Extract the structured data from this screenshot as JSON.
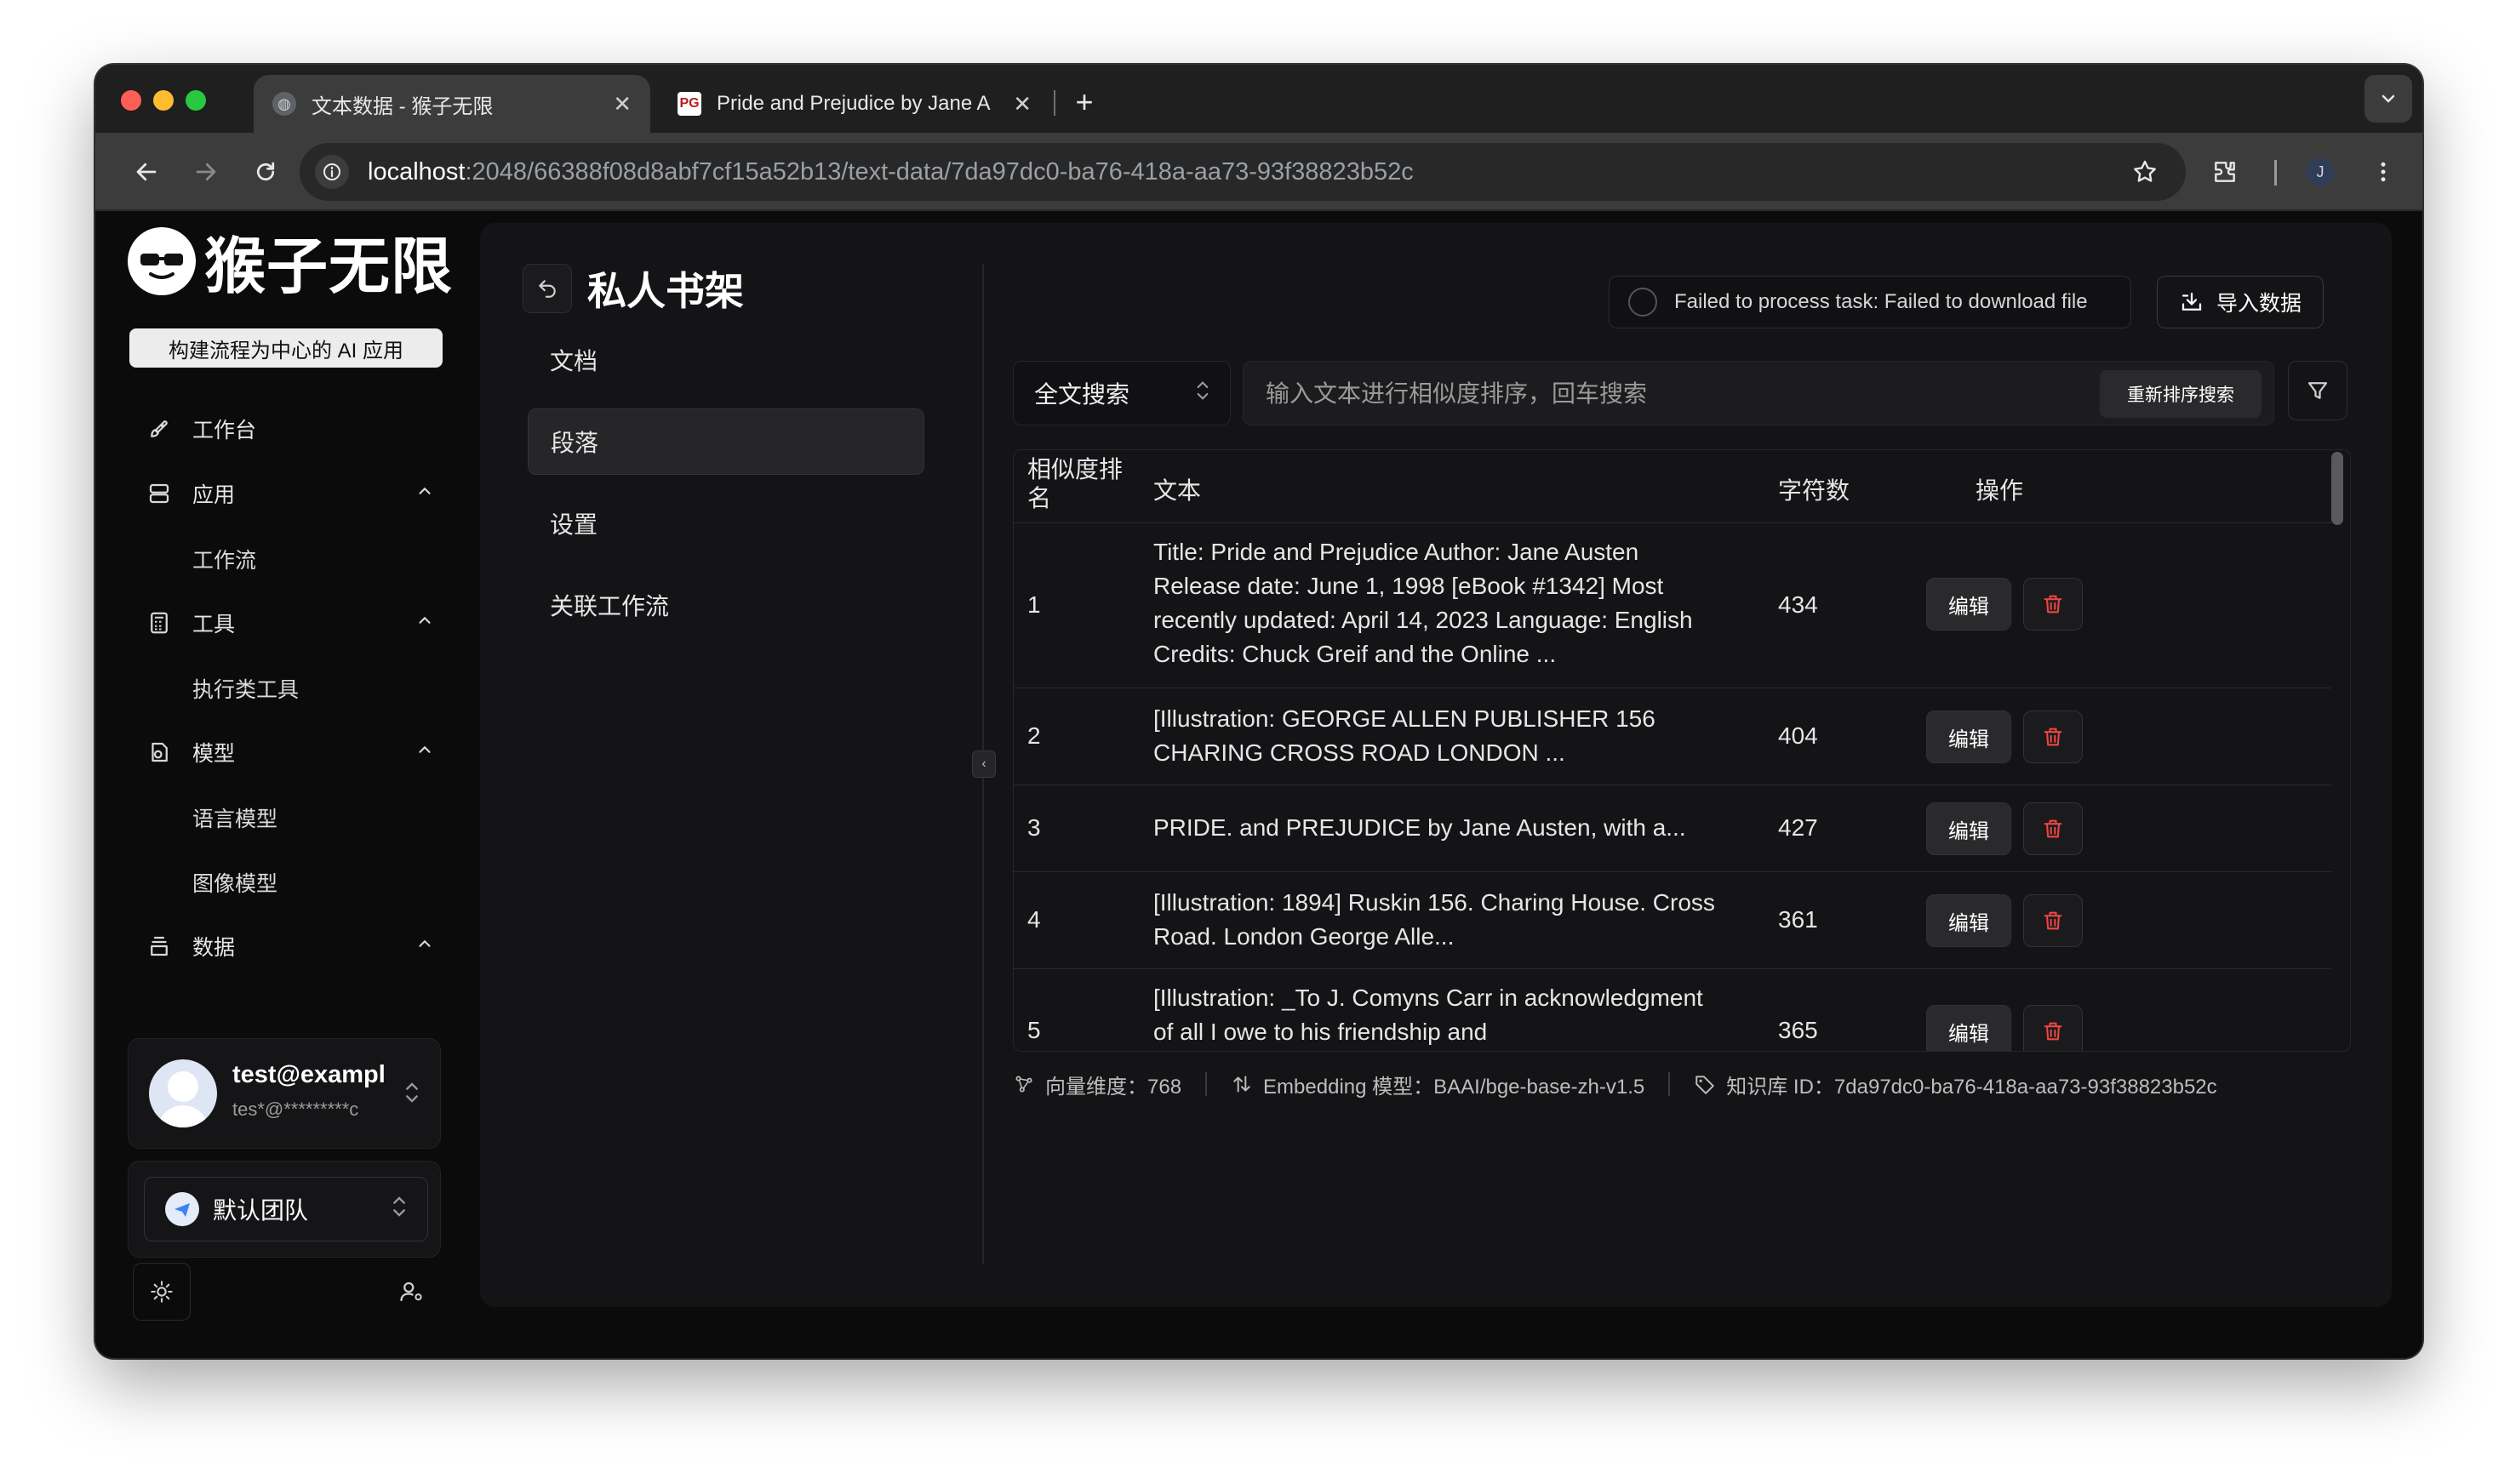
{
  "browser": {
    "tabs": [
      {
        "title": "文本数据 - 猴子无限",
        "active": true
      },
      {
        "title": "Pride and Prejudice by Jane A",
        "active": false
      }
    ],
    "url_host": "localhost",
    "url_path": ":2048/66388f08d8abf7cf15a52b13/text-data/7da97dc0-ba76-418a-aa73-93f38823b52c",
    "profile_initial": "J"
  },
  "sidebar": {
    "logo_text": "猴子无限",
    "tagline": "构建流程为中心的 AI 应用",
    "items": [
      {
        "label": "工作台",
        "icon": "rocket-icon"
      },
      {
        "label": "应用",
        "icon": "app-icon",
        "expanded": true
      },
      {
        "label": "工作流",
        "sub": true
      },
      {
        "label": "工具",
        "icon": "calculator-icon",
        "expanded": true
      },
      {
        "label": "执行类工具",
        "sub": true
      },
      {
        "label": "模型",
        "icon": "model-icon",
        "expanded": true
      },
      {
        "label": "语言模型",
        "sub": true
      },
      {
        "label": "图像模型",
        "sub": true
      },
      {
        "label": "数据",
        "icon": "database-icon",
        "expanded": true
      }
    ],
    "user": {
      "name": "test@exampl",
      "email": "tes*@*********c"
    },
    "team": {
      "name": "默认团队"
    }
  },
  "main": {
    "title": "私人书架",
    "nav": [
      "文档",
      "段落",
      "设置",
      "关联工作流"
    ],
    "active_nav": "段落",
    "status_text": "Failed to process task: Failed to download file",
    "import_label": "导入数据",
    "search_type": "全文搜索",
    "search_placeholder": "输入文本进行相似度排序，回车搜索",
    "rerank_label": "重新排序搜索",
    "table": {
      "headers": [
        "相似度排名",
        "文本",
        "字符数",
        "操作"
      ],
      "rows": [
        {
          "rank": "1",
          "text": "Title: Pride and Prejudice Author: Jane Austen Release date: June 1, 1998 [eBook #1342] Most recently updated: April 14, 2023 Language: English Credits: Chuck Greif and the Online ...",
          "chars": "434"
        },
        {
          "rank": "2",
          "text": "[Illustration: GEORGE ALLEN PUBLISHER 156 CHARING CROSS ROAD LONDON ...",
          "chars": "404"
        },
        {
          "rank": "3",
          "text": "PRIDE. and PREJUDICE by Jane Austen, with a...",
          "chars": "427"
        },
        {
          "rank": "4",
          "text": "[Illustration: 1894] Ruskin 156. Charing House. Cross Road. London George Alle...",
          "chars": "361"
        },
        {
          "rank": "5",
          "text": "[Illustration: _To J. Comyns Carr in acknowledgment of all I owe to his friendship and",
          "chars": "365"
        }
      ],
      "edit_label": "编辑"
    },
    "footer": {
      "dimension": "向量维度：768",
      "embedding": "Embedding 模型：BAAI/bge-base-zh-v1.5",
      "kb_id": "知识库 ID：7da97dc0-ba76-418a-aa73-93f38823b52c"
    }
  },
  "colors": {
    "danger": "#ef4444",
    "panel": "#141416",
    "background": "#0b0b0c"
  }
}
